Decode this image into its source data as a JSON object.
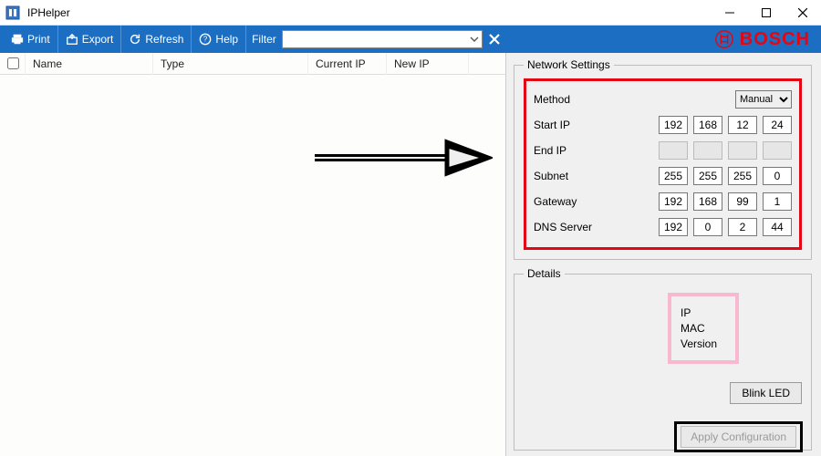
{
  "window": {
    "title": "IPHelper"
  },
  "toolbar": {
    "print": "Print",
    "export": "Export",
    "refresh": "Refresh",
    "help": "Help",
    "filter_label": "Filter",
    "filter_value": ""
  },
  "brand": {
    "wordmark": "BOSCH"
  },
  "table": {
    "columns": {
      "name": "Name",
      "type": "Type",
      "current_ip": "Current IP",
      "new_ip": "New IP"
    }
  },
  "network": {
    "legend": "Network Settings",
    "method_label": "Method",
    "method_value": "Manual",
    "rows": {
      "start_ip": {
        "label": "Start IP",
        "oct": [
          "192",
          "168",
          "12",
          "24"
        ],
        "enabled": true
      },
      "end_ip": {
        "label": "End IP",
        "oct": [
          "",
          "",
          "",
          ""
        ],
        "enabled": false
      },
      "subnet": {
        "label": "Subnet",
        "oct": [
          "255",
          "255",
          "255",
          "0"
        ],
        "enabled": true
      },
      "gateway": {
        "label": "Gateway",
        "oct": [
          "192",
          "168",
          "99",
          "1"
        ],
        "enabled": true
      },
      "dns": {
        "label": "DNS Server",
        "oct": [
          "192",
          "0",
          "2",
          "44"
        ],
        "enabled": true
      }
    }
  },
  "details": {
    "legend": "Details",
    "ip_label": "IP",
    "mac_label": "MAC",
    "version_label": "Version",
    "blink_led": "Blink LED"
  },
  "apply": {
    "label": "Apply Configuration"
  }
}
